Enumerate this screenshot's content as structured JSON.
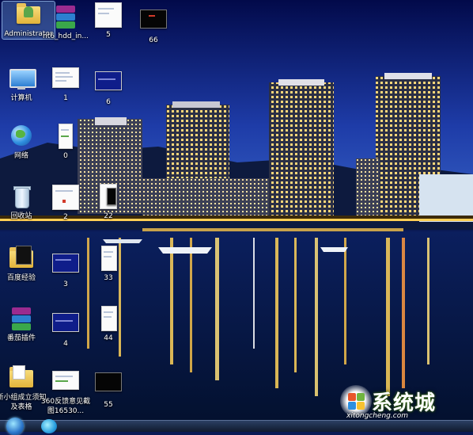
{
  "desktop": {
    "icons": [
      {
        "label": "Administrator",
        "type": "folder-user",
        "selected": true
      },
      {
        "label": "nt6_hdd_in...",
        "type": "winrar"
      },
      {
        "label": "5",
        "type": "screenshot-white"
      },
      {
        "label": "66",
        "type": "screenshot-black"
      },
      {
        "label": "计算机",
        "type": "computer"
      },
      {
        "label": "1",
        "type": "screenshot-white"
      },
      {
        "label": "6",
        "type": "screenshot-blue"
      },
      {
        "label": "网络",
        "type": "network"
      },
      {
        "label": "0",
        "type": "screenshot-white"
      },
      {
        "label": "回收站",
        "type": "recycle-bin"
      },
      {
        "label": "2",
        "type": "screenshot-white"
      },
      {
        "label": "22",
        "type": "screenshot-white"
      },
      {
        "label": "百度经验",
        "type": "folder"
      },
      {
        "label": "3",
        "type": "screenshot-blue"
      },
      {
        "label": "33",
        "type": "screenshot-white"
      },
      {
        "label": "番茄插件",
        "type": "winrar"
      },
      {
        "label": "4",
        "type": "screenshot-blue"
      },
      {
        "label": "44",
        "type": "screenshot-white"
      },
      {
        "label": "新小组成立须知及表格",
        "type": "folder"
      },
      {
        "label": "360反馈意见截图16530...",
        "type": "screenshot-white"
      },
      {
        "label": "55",
        "type": "screenshot-black"
      }
    ]
  },
  "taskbar": {
    "start_icon": "windows-start-orb",
    "pinned": [
      "360-browser"
    ]
  },
  "watermark": {
    "text": "系统城",
    "url": "xitongcheng.com"
  },
  "colors": {
    "sky_top": "#020a4a",
    "sky_bottom": "#1f3aa0",
    "water": "#041232",
    "light": "#ffd35a",
    "watermark_green": "#4a8b1a"
  }
}
